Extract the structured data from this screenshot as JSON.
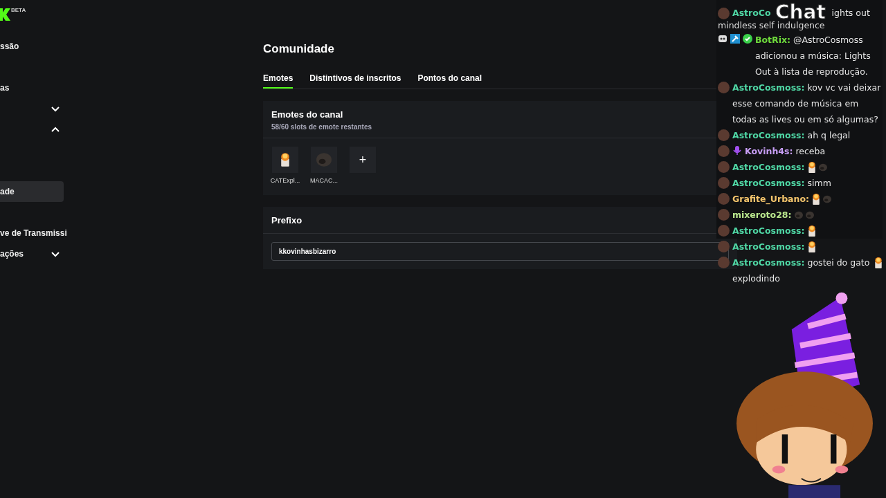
{
  "logo": {
    "badge": "BETA"
  },
  "sidebar": {
    "items": [
      {
        "label": "ssão",
        "selected": false
      },
      {
        "label": "as",
        "selected": false
      },
      {
        "expanded": false,
        "selected": false
      },
      {
        "expanded": true,
        "selected": false,
        "children": [
          {
            "label": "ade",
            "selected": true
          },
          {
            "label": "ve de Transmissi",
            "selected": false
          }
        ]
      },
      {
        "label": "ações",
        "expanded": false,
        "selected": false
      }
    ]
  },
  "page": {
    "title": "Comunidade",
    "tabs": [
      {
        "label": "Emotes",
        "selected": true
      },
      {
        "label": "Distintivos de inscritos",
        "selected": false
      },
      {
        "label": "Pontos do canal",
        "selected": false
      }
    ],
    "emotes_card": {
      "title": "Emotes do canal",
      "subtitle": "58/60 slots de emote restantes",
      "emotes": [
        {
          "kind": "cat",
          "name": "CATExpl..."
        },
        {
          "kind": "monkey",
          "name": "MACAC..."
        }
      ],
      "add_button": "+"
    },
    "prefix_card": {
      "title": "Prefixo",
      "value": "kkovinhasbizarro"
    }
  },
  "chat": {
    "title": "Chat",
    "messages": [
      {
        "user": "AstroCo",
        "text": "ights out",
        "continuation": "mindless self indulgence",
        "color": "#4fd6a4",
        "badges": [
          {
            "kind": "avatar"
          }
        ]
      },
      {
        "user": "BotRix:",
        "text": "@AstroCosmoss adicionou a música: Lights Out à lista de reprodução.",
        "color": "#6fdc3c",
        "badges": [
          {
            "kind": "bot"
          },
          {
            "kind": "mod"
          },
          {
            "kind": "verified"
          }
        ]
      },
      {
        "user": "AstroCosmoss:",
        "text": "kov vc vai deixar esse comando de música em todas as lives ou em só algumas?",
        "color": "#4fd6a4",
        "badges": [
          {
            "kind": "avatar"
          }
        ]
      },
      {
        "user": "AstroCosmoss:",
        "text": "ah q legal",
        "color": "#4fd6a4",
        "badges": [
          {
            "kind": "avatar"
          }
        ]
      },
      {
        "user": "Kovinh4s:",
        "text": "receba",
        "color": "#c79ef5",
        "badges": [
          {
            "kind": "avatar"
          },
          {
            "kind": "mic"
          }
        ]
      },
      {
        "user": "AstroCosmoss:",
        "emotes": [
          {
            "kind": "cat"
          },
          {
            "kind": "monkey"
          }
        ],
        "color": "#4fd6a4",
        "badges": [
          {
            "kind": "avatar"
          }
        ]
      },
      {
        "user": "AstroCosmoss:",
        "text": "simm",
        "color": "#4fd6a4",
        "badges": [
          {
            "kind": "avatar"
          }
        ]
      },
      {
        "user": "Grafite_Urbano:",
        "emotes": [
          {
            "kind": "cat"
          },
          {
            "kind": "monkey"
          }
        ],
        "color": "#f3c46c",
        "badges": [
          {
            "kind": "avatar"
          }
        ]
      },
      {
        "user": "mixeroto28:",
        "emotes": [
          {
            "kind": "monkey"
          },
          {
            "kind": "monkey"
          }
        ],
        "color": "#b9e68d",
        "badges": [
          {
            "kind": "avatar"
          }
        ]
      },
      {
        "user": "AstroCosmoss:",
        "emotes": [
          {
            "kind": "cat"
          }
        ],
        "color": "#4fd6a4",
        "badges": [
          {
            "kind": "avatar"
          }
        ]
      },
      {
        "user": "AstroCosmoss:",
        "emotes": [
          {
            "kind": "cat"
          }
        ],
        "color": "#4fd6a4",
        "badges": [
          {
            "kind": "avatar"
          }
        ]
      },
      {
        "user": "AstroCosmoss:",
        "text": "gostei do gato explodindo",
        "emotes": [
          {
            "kind": "cat"
          }
        ],
        "color": "#4fd6a4",
        "badges": [
          {
            "kind": "avatar"
          }
        ]
      }
    ]
  }
}
